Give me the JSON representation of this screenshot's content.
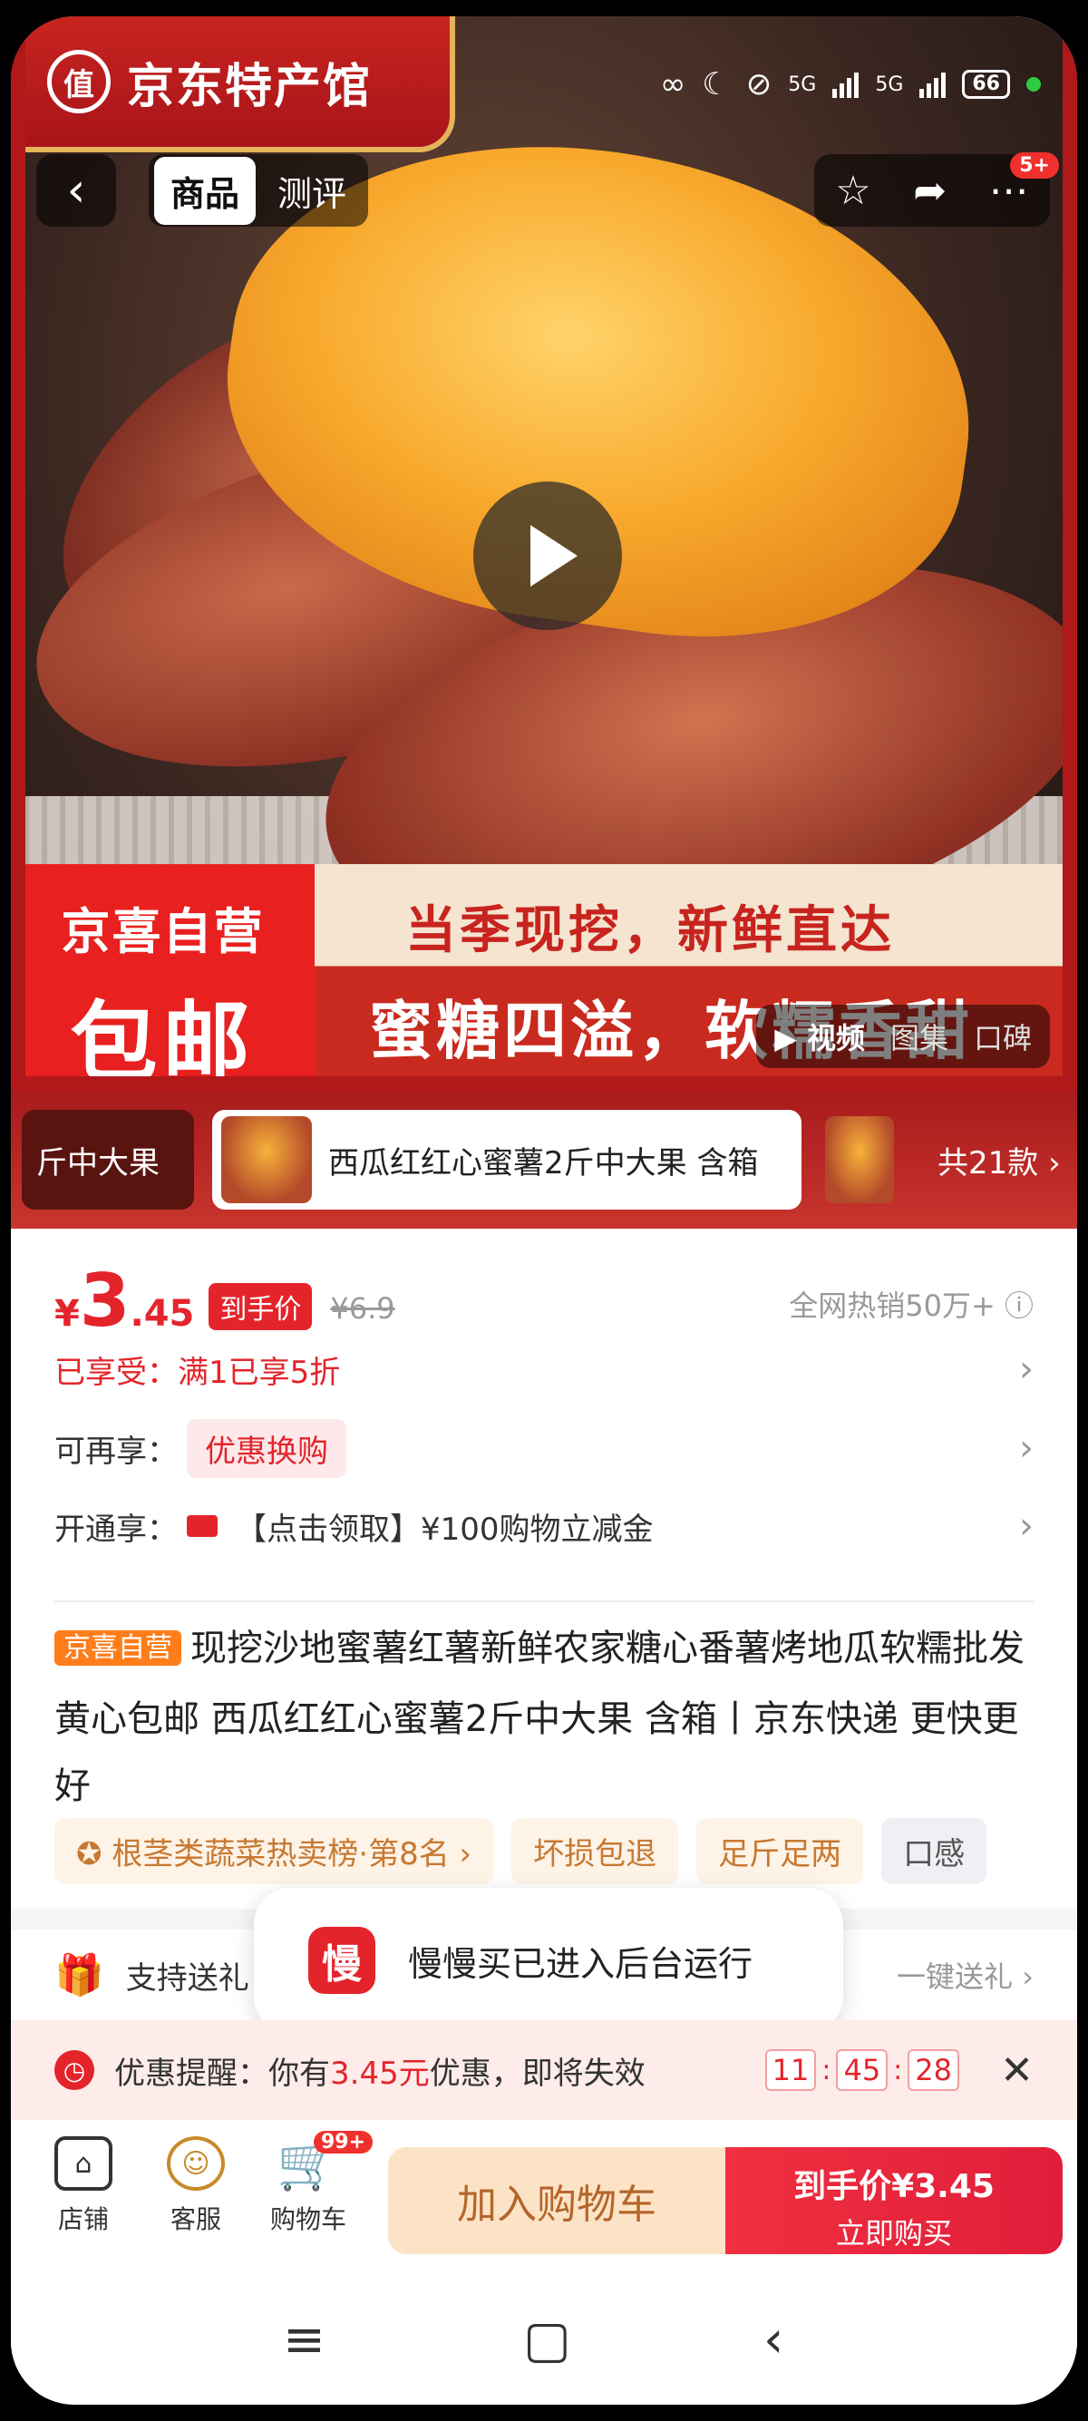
{
  "hero": {
    "brand_logo": "值",
    "brand_name": "京东特产馆",
    "status": {
      "net1": "5G",
      "net2": "5G",
      "battery": "66"
    },
    "tabs": [
      "商品",
      "测评"
    ],
    "more_badge": "5+",
    "promo_line1": "京喜自营",
    "promo_line2": "包邮",
    "banner_line1": "当季现挖，新鲜直达",
    "banner_line2": "蜜糖四溢，软糯香甜",
    "media_tabs": [
      "视频",
      "图集",
      "口碑"
    ]
  },
  "variants": {
    "items": [
      "斤中大果",
      "西瓜红红心蜜薯2斤中大果 含箱"
    ],
    "count_label": "共21款"
  },
  "price": {
    "currency": "¥",
    "integer": "3",
    "decimal": ".45",
    "final_tag": "到手价",
    "original": "¥6.9",
    "sales": "全网热销50万+"
  },
  "rows": {
    "enjoyed": "已享受：满1已享5折",
    "more_label": "可再享：",
    "more_pill": "优惠换购",
    "open_label": "开通享：",
    "open_text": "【点击领取】¥100购物立减金"
  },
  "title": {
    "badge": "京喜自营",
    "text": "现挖沙地蜜薯红薯新鲜农家糖心番薯烤地瓜软糯批发黄心包邮 西瓜红红心蜜薯2斤中大果 含箱丨京东快递 更快更好"
  },
  "chips": [
    "根茎类蔬菜热卖榜·第8名 ›",
    "坏损包退",
    "足斤足两",
    "口感"
  ],
  "gift": {
    "label": "支持送礼",
    "right": "一键送礼 ›"
  },
  "toast": {
    "icon_text": "慢",
    "text": "慢慢买已进入后台运行"
  },
  "reminder": {
    "prefix": "优惠提醒：你有",
    "amount": "3.45元",
    "suffix": "优惠，即将失效",
    "h": "11",
    "m": "45",
    "s": "28"
  },
  "bottom": {
    "shop": "店铺",
    "service": "客服",
    "cart": "购物车",
    "cart_badge": "99+",
    "add_cart": "加入购物车",
    "buy_line1": "到手价¥3.45",
    "buy_line2": "立即购买"
  }
}
